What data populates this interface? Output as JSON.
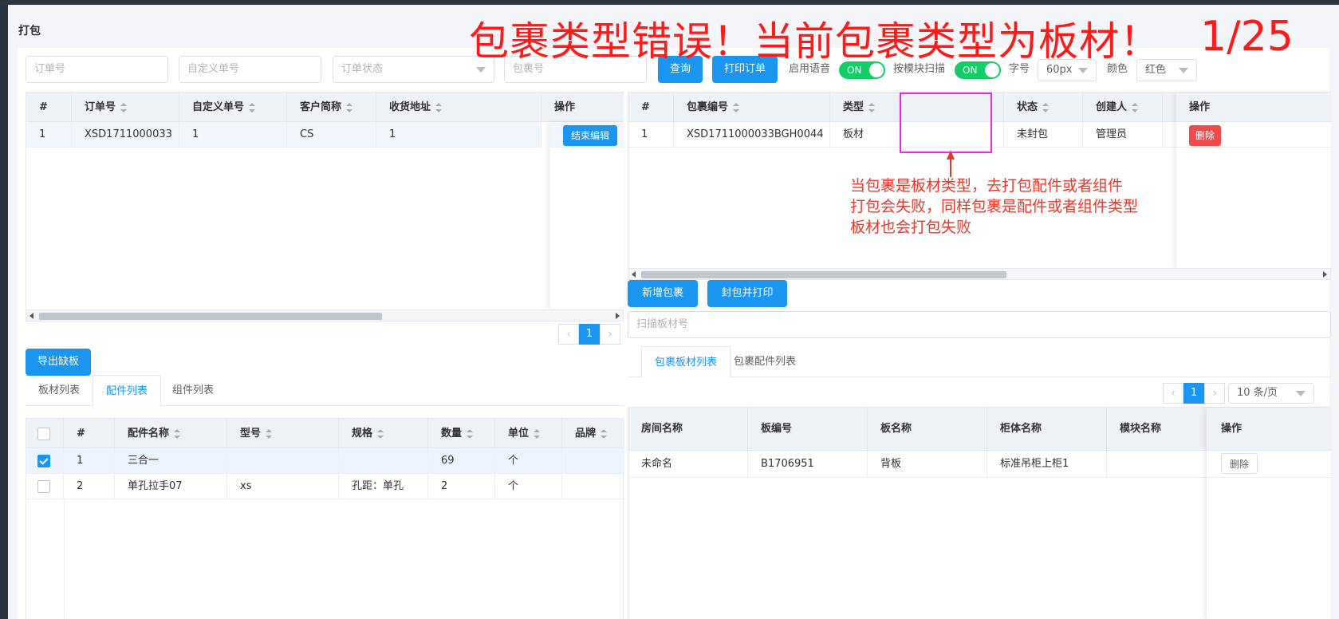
{
  "page": {
    "title": "打包"
  },
  "overlay": {
    "headline": "包裹类型错误！当前包裹类型为板材！",
    "counter": "1/25",
    "note_lines": [
      "当包裹是板材类型，去打包配件或者组件",
      "打包会失败，同样包裹是配件或者组件类型",
      "板材也会打包失败"
    ]
  },
  "toolbar": {
    "order_no_placeholder": "订单号",
    "custom_no_placeholder": "自定义单号",
    "order_status_placeholder": "订单状态",
    "package_no_placeholder": "包裹号",
    "query_label": "查询",
    "print_order_label": "打印订单",
    "voice_label": "启用语音",
    "voice_switch": "ON",
    "module_scan_label": "按模块扫描",
    "module_scan_switch": "ON",
    "font_size_label": "字号",
    "font_size_value": "60px",
    "color_label": "颜色",
    "color_value": "红色"
  },
  "orders_table": {
    "columns": [
      "#",
      "订单号",
      "自定义单号",
      "客户简称",
      "收货地址",
      "操作"
    ],
    "rows": [
      {
        "idx": "1",
        "order_no": "XSD1711000033",
        "custom_no": "1",
        "customer": "CS",
        "address": "1",
        "action": "结束编辑"
      }
    ],
    "pager": {
      "current": "1"
    }
  },
  "packages_table": {
    "columns": [
      "#",
      "包裹编号",
      "类型",
      "状态",
      "创建人",
      "操作"
    ],
    "rows": [
      {
        "idx": "1",
        "package_no": "XSD1711000033BGH0044",
        "type": "板材",
        "status": "未封包",
        "creator": "管理员",
        "action": "删除"
      }
    ]
  },
  "package_actions": {
    "new_package": "新增包裹",
    "seal_print": "封包并打印",
    "scan_placeholder": "扫描板材号"
  },
  "package_tabs": [
    "包裹板材列表",
    "包裹配件列表"
  ],
  "package_pager": {
    "current": "1",
    "page_size": "10 条/页"
  },
  "boards_table": {
    "columns": [
      "房间名称",
      "板编号",
      "板名称",
      "柜体名称",
      "模块名称",
      "操作"
    ],
    "rows": [
      {
        "room": "未命名",
        "board_no": "B1706951",
        "board_name": "背板",
        "cabinet": "标准吊柜上柜1",
        "module": "",
        "action": "删除"
      }
    ]
  },
  "export_label": "导出缺板",
  "item_tabs": [
    "板材列表",
    "配件列表",
    "组件列表"
  ],
  "parts_table": {
    "columns": [
      "#",
      "配件名称",
      "型号",
      "规格",
      "数量",
      "单位",
      "品牌"
    ],
    "rows": [
      {
        "checked": true,
        "idx": "1",
        "name": "三合一",
        "model": "",
        "spec": "",
        "qty": "69",
        "unit": "个",
        "brand": ""
      },
      {
        "checked": false,
        "idx": "2",
        "name": "单孔拉手07",
        "model": "xs",
        "spec": "孔距：单孔",
        "qty": "2",
        "unit": "个",
        "brand": ""
      }
    ]
  },
  "colors": {
    "primary": "#1a96f0",
    "switch_on": "#13ce66",
    "danger": "#f14a4a",
    "headline": "#ff1a1a",
    "annotation_box": "#e62ae6"
  }
}
